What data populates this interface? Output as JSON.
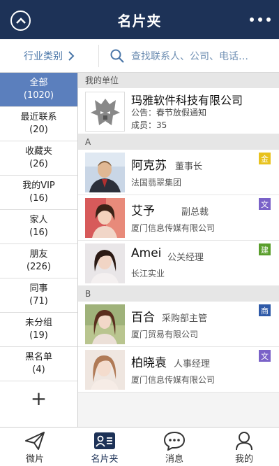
{
  "header": {
    "title": "名片夹"
  },
  "filter": {
    "industry_label": "行业类别",
    "search_placeholder": "查找联系人、公司、电话…"
  },
  "sidebar": {
    "items": [
      {
        "label": "全部",
        "count": "(1020)"
      },
      {
        "label": "最近联系",
        "count": "(20)"
      },
      {
        "label": "收藏夹",
        "count": "(26)"
      },
      {
        "label": "我的VIP",
        "count": "(16)"
      },
      {
        "label": "家人",
        "count": "(16)"
      },
      {
        "label": "朋友",
        "count": "(226)"
      },
      {
        "label": "同事",
        "count": "(71)"
      },
      {
        "label": "未分组",
        "count": "(19)"
      },
      {
        "label": "黑名单",
        "count": "(4)"
      }
    ],
    "add_label": "+"
  },
  "my_unit": {
    "section_label": "我的单位",
    "name": "玛雅软件科技有限公司",
    "notice": "公告：春节放假通知",
    "members": "成员：35"
  },
  "groups": [
    {
      "letter": "A",
      "contacts": [
        {
          "name": "阿克苏",
          "role": "董事长",
          "company": "法国翡翠集团",
          "tag": "金",
          "tag_color": "#e8c21e"
        },
        {
          "name": "艾予",
          "role": "副总裁",
          "company": "厦门信息传媒有限公司",
          "tag": "文",
          "tag_color": "#7a62c8"
        },
        {
          "name": "Amei",
          "role": "公关经理",
          "company": "长江实业",
          "tag": "建",
          "tag_color": "#5a9e2c"
        }
      ]
    },
    {
      "letter": "B",
      "contacts": [
        {
          "name": "百合",
          "role": "采购部主管",
          "company": "厦门贸易有限公司",
          "tag": "商",
          "tag_color": "#2f5aa8"
        },
        {
          "name": "柏晓袁",
          "role": "人事经理",
          "company": "厦门信息传媒有限公司",
          "tag": "文",
          "tag_color": "#7a62c8"
        }
      ]
    }
  ],
  "tabbar": {
    "tabs": [
      {
        "label": "微片",
        "icon": "paper-plane-icon"
      },
      {
        "label": "名片夹",
        "icon": "card-holder-icon"
      },
      {
        "label": "消息",
        "icon": "chat-bubble-icon"
      },
      {
        "label": "我的",
        "icon": "user-icon"
      }
    ]
  },
  "colors": {
    "header_bg": "#1d3257",
    "active_sidebar": "#5b7fbd",
    "accent_text": "#4a76a8"
  }
}
